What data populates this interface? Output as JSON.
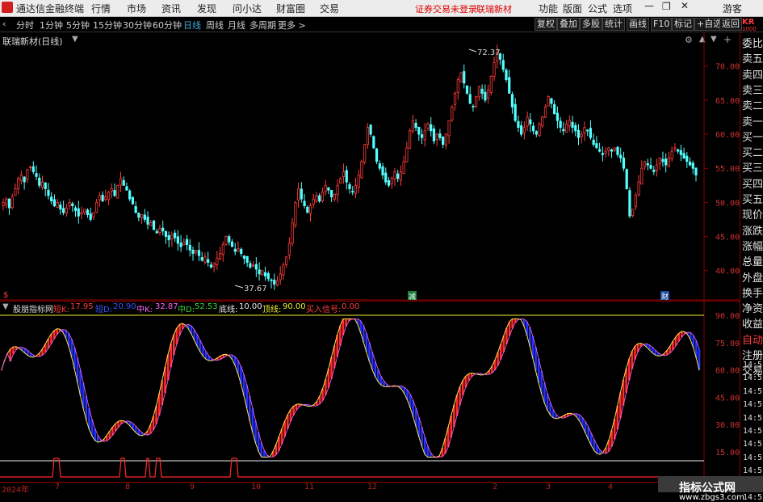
{
  "titlebar": {
    "app_name": "通达信金融终端",
    "menu": [
      "行情",
      "市场",
      "资讯",
      "发现",
      "问小达",
      "财富圈",
      "交易"
    ],
    "notice": "证券交易未登录",
    "stock": "联瑞新材",
    "right_menu": [
      "功能",
      "版面",
      "公式",
      "选项"
    ],
    "user": "游客"
  },
  "toolbar": {
    "periods": [
      "分时",
      "1分钟",
      "5分钟",
      "15分钟",
      "30分钟",
      "60分钟",
      "日线",
      "周线",
      "月线",
      "多周期",
      "更多 >"
    ],
    "active_period": "日线",
    "right_buttons": [
      "复权",
      "叠加",
      "多股",
      "统计",
      "画线",
      "F10",
      "标记",
      "+自选",
      "返回"
    ]
  },
  "main_chart": {
    "title": "联瑞新材(日线)",
    "high_label": "72.37",
    "low_label": "37.67",
    "marker_left": "$",
    "marker_mid": "减",
    "marker_right": "财",
    "y_ticks": [
      "70.00",
      "65.00",
      "60.00",
      "55.00",
      "50.00",
      "45.00",
      "40.00"
    ]
  },
  "indicator": {
    "name": "股朋指标网",
    "params": [
      {
        "label": "短K:",
        "value": "17.95",
        "color": "#ff3b3b"
      },
      {
        "label": "短D:",
        "value": "20.90",
        "color": "#3355ff"
      },
      {
        "label": "中K:",
        "value": "32.87",
        "color": "#ff66ff"
      },
      {
        "label": "中D:",
        "value": "52.53",
        "color": "#33dd33"
      },
      {
        "label": "底线:",
        "value": "10.00",
        "color": "#eeeeee"
      },
      {
        "label": "顶线:",
        "value": "90.00",
        "color": "#eeee33"
      },
      {
        "label": "买入信号:",
        "value": "0.00",
        "color": "#ff3b3b"
      }
    ],
    "y_ticks": [
      "90.00",
      "75.00",
      "60.00",
      "45.00",
      "30.00",
      "15.00"
    ]
  },
  "x_axis": {
    "labels": [
      "2024年",
      "7",
      "8",
      "9",
      "10",
      "11",
      "12",
      "2",
      "3",
      "4"
    ]
  },
  "right_panel": {
    "header": "KR",
    "header_sub": "1000",
    "items": [
      "委比",
      "卖五",
      "卖四",
      "卖三",
      "卖二",
      "卖一",
      "买一",
      "买二",
      "买三",
      "买四",
      "买五",
      "现价",
      "涨跌",
      "涨幅",
      "总量",
      "外盘",
      "换手",
      "净资",
      "收益",
      "自动",
      "注册",
      "交易"
    ],
    "times": [
      "14:5",
      "14:5",
      "14:5",
      "14:5",
      "14:5",
      "14:5",
      "14:5",
      "14:5",
      "14:5",
      "14:5",
      "14:5"
    ]
  },
  "watermark": {
    "title": "指标公式网",
    "url": "www.zbgs3.com"
  },
  "chart_data": {
    "type": "candlestick",
    "title": "联瑞新材(日线)",
    "ylim": [
      37,
      74
    ],
    "closes": [
      50.0,
      50.5,
      49.2,
      50.8,
      52.0,
      53.5,
      54.0,
      53.0,
      54.8,
      55.2,
      54.5,
      53.8,
      52.5,
      53.0,
      52.0,
      51.0,
      50.2,
      49.5,
      50.0,
      49.0,
      48.5,
      49.2,
      50.0,
      49.5,
      48.8,
      48.0,
      48.5,
      49.0,
      48.2,
      47.5,
      48.5,
      50.0,
      51.0,
      50.2,
      50.8,
      51.5,
      52.0,
      51.0,
      52.5,
      53.5,
      52.5,
      51.8,
      50.5,
      49.8,
      48.5,
      47.8,
      48.2,
      47.5,
      46.8,
      47.0,
      46.0,
      45.5,
      46.2,
      45.8,
      45.0,
      44.5,
      45.2,
      44.8,
      44.0,
      43.5,
      44.2,
      43.8,
      43.0,
      42.5,
      43.0,
      42.2,
      41.5,
      42.0,
      41.2,
      40.5,
      41.0,
      41.8,
      42.5,
      43.8,
      45.0,
      44.2,
      43.5,
      42.8,
      43.2,
      42.5,
      41.8,
      41.2,
      40.5,
      40.8,
      40.2,
      39.5,
      40.0,
      39.2,
      38.8,
      38.5,
      38.0,
      38.5,
      39.5,
      40.8,
      42.0,
      44.0,
      47.0,
      50.0,
      52.0,
      50.5,
      49.5,
      48.5,
      49.5,
      50.5,
      51.0,
      50.2,
      51.5,
      52.5,
      51.8,
      50.8,
      51.2,
      52.5,
      53.5,
      54.5,
      53.0,
      52.0,
      51.5,
      52.5,
      54.0,
      56.0,
      58.5,
      61.0,
      60.0,
      58.0,
      56.0,
      55.0,
      54.0,
      53.0,
      52.5,
      53.5,
      54.5,
      53.5,
      54.5,
      56.0,
      58.0,
      60.5,
      62.0,
      61.0,
      60.0,
      59.5,
      60.5,
      61.5,
      60.5,
      59.0,
      60.0,
      59.5,
      58.5,
      60.0,
      62.0,
      64.0,
      66.0,
      68.0,
      69.0,
      67.5,
      66.0,
      64.5,
      64.0,
      65.5,
      67.0,
      66.0,
      65.0,
      66.5,
      68.5,
      70.5,
      72.0,
      71.0,
      69.5,
      68.0,
      66.0,
      64.0,
      62.0,
      61.0,
      60.0,
      61.0,
      62.5,
      61.5,
      60.5,
      60.0,
      61.5,
      62.5,
      64.0,
      65.5,
      64.5,
      63.0,
      62.0,
      61.0,
      60.5,
      61.5,
      62.0,
      61.0,
      60.5,
      59.5,
      60.0,
      61.0,
      60.5,
      59.5,
      58.5,
      58.0,
      57.5,
      57.0,
      57.5,
      58.0,
      57.5,
      58.0,
      57.0,
      56.5,
      55.0,
      52.0,
      48.0,
      49.0,
      51.0,
      53.0,
      55.0,
      56.0,
      55.5,
      55.0,
      54.5,
      55.5,
      56.5,
      56.0,
      55.5,
      56.5,
      57.5,
      58.0,
      57.5,
      57.0,
      56.5,
      56.0,
      55.5,
      55.0,
      54.0
    ]
  }
}
